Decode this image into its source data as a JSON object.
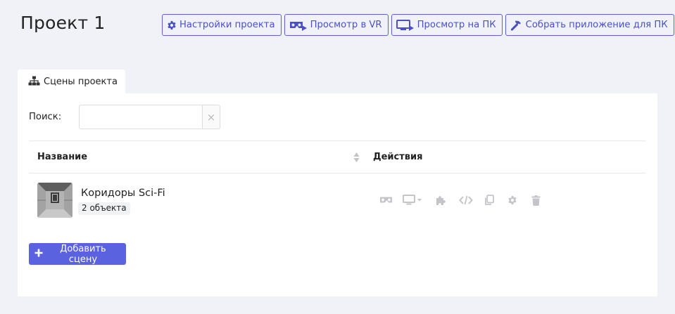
{
  "page": {
    "title": "Проект 1"
  },
  "toolbar": {
    "settings_label": "Настройки проекта",
    "vr_label": "Просмотр в VR",
    "pc_label": "Просмотр на ПК",
    "build_label": "Собрать приложение для ПК"
  },
  "tabs": [
    {
      "label": "Сцены проекта",
      "active": true
    }
  ],
  "search": {
    "label": "Поиск:",
    "value": "",
    "placeholder": "",
    "clear_icon": "×"
  },
  "table": {
    "columns": [
      "Название",
      "Действия"
    ],
    "rows": [
      {
        "name": "Коридоры Sci-Fi",
        "count": "2 объекта"
      }
    ]
  },
  "add_scene": {
    "label": "Добавить сцену"
  },
  "colors": {
    "accent": "#5b62e0",
    "accent_text": "#4a50c8",
    "background": "#f1f2f7",
    "icon_muted": "#c4c5ca"
  },
  "icons": [
    "gear-icon",
    "vr-headset-icon",
    "monitor-play-icon",
    "hammer-icon",
    "sitemap-icon",
    "sort-icon",
    "puzzle-icon",
    "code-icon",
    "copy-icon",
    "trash-icon",
    "plus-icon"
  ]
}
